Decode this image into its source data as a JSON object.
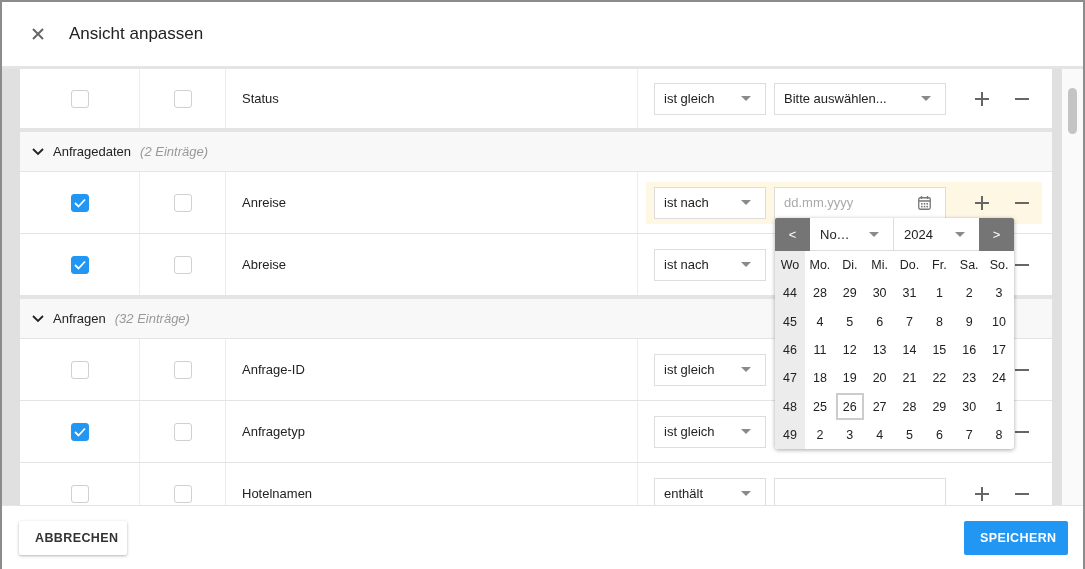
{
  "dialog": {
    "title": "Ansicht anpassen"
  },
  "sections": [
    {
      "rows": [
        {
          "label": "Status",
          "checks": [
            false,
            false
          ],
          "highlighted": false,
          "operator": "ist gleich",
          "value": {
            "kind": "select",
            "text": "Bitte auswählen..."
          }
        }
      ]
    },
    {
      "title": "Anfragedaten",
      "count": "(2 Einträge)",
      "expanded": true,
      "rows": [
        {
          "label": "Anreise",
          "checks": [
            true,
            false
          ],
          "highlighted": true,
          "operator": "ist nach",
          "value": {
            "kind": "date",
            "placeholder": "dd.mm.yyyy"
          }
        },
        {
          "label": "Abreise",
          "checks": [
            true,
            false
          ],
          "highlighted": false,
          "operator": "ist nach"
        }
      ]
    },
    {
      "title": "Anfragen",
      "count": "(32 Einträge)",
      "expanded": true,
      "rows": [
        {
          "label": "Anfrage-ID",
          "checks": [
            false,
            false
          ],
          "highlighted": false,
          "operator": "ist gleich"
        },
        {
          "label": "Anfragetyp",
          "checks": [
            true,
            false
          ],
          "highlighted": false,
          "operator": "ist gleich"
        },
        {
          "label": "Hotelnamen",
          "checks": [
            false,
            false
          ],
          "highlighted": false,
          "operator": "enthält",
          "value": {
            "kind": "text"
          }
        }
      ]
    }
  ],
  "calendar": {
    "prev": "<",
    "month": "No…",
    "year": "2024",
    "next": ">",
    "week_label": "Wo",
    "weekdays": [
      "Mo.",
      "Di.",
      "Mi.",
      "Do.",
      "Fr.",
      "Sa.",
      "So."
    ],
    "weeks": [
      {
        "number": "44",
        "days": [
          {
            "day": "28",
            "selected": false
          },
          {
            "day": "29",
            "selected": false
          },
          {
            "day": "30",
            "selected": false
          },
          {
            "day": "31",
            "selected": false
          },
          {
            "day": "1",
            "selected": false
          },
          {
            "day": "2",
            "selected": false
          },
          {
            "day": "3",
            "selected": false
          }
        ]
      },
      {
        "number": "45",
        "days": [
          {
            "day": "4",
            "selected": false
          },
          {
            "day": "5",
            "selected": false
          },
          {
            "day": "6",
            "selected": false
          },
          {
            "day": "7",
            "selected": false
          },
          {
            "day": "8",
            "selected": false
          },
          {
            "day": "9",
            "selected": false
          },
          {
            "day": "10",
            "selected": false
          }
        ]
      },
      {
        "number": "46",
        "days": [
          {
            "day": "11",
            "selected": false
          },
          {
            "day": "12",
            "selected": false
          },
          {
            "day": "13",
            "selected": false
          },
          {
            "day": "14",
            "selected": false
          },
          {
            "day": "15",
            "selected": false
          },
          {
            "day": "16",
            "selected": false
          },
          {
            "day": "17",
            "selected": false
          }
        ]
      },
      {
        "number": "47",
        "days": [
          {
            "day": "18",
            "selected": false
          },
          {
            "day": "19",
            "selected": false
          },
          {
            "day": "20",
            "selected": false
          },
          {
            "day": "21",
            "selected": false
          },
          {
            "day": "22",
            "selected": false
          },
          {
            "day": "23",
            "selected": false
          },
          {
            "day": "24",
            "selected": false
          }
        ]
      },
      {
        "number": "48",
        "days": [
          {
            "day": "25",
            "selected": false
          },
          {
            "day": "26",
            "selected": true
          },
          {
            "day": "27",
            "selected": false
          },
          {
            "day": "28",
            "selected": false
          },
          {
            "day": "29",
            "selected": false
          },
          {
            "day": "30",
            "selected": false
          },
          {
            "day": "1",
            "selected": false
          }
        ]
      },
      {
        "number": "49",
        "days": [
          {
            "day": "2",
            "selected": false
          },
          {
            "day": "3",
            "selected": false
          },
          {
            "day": "4",
            "selected": false
          },
          {
            "day": "5",
            "selected": false
          },
          {
            "day": "6",
            "selected": false
          },
          {
            "day": "7",
            "selected": false
          },
          {
            "day": "8",
            "selected": false
          }
        ]
      }
    ]
  },
  "footer": {
    "cancel": "ABBRECHEN",
    "save": "SPEICHERN"
  }
}
